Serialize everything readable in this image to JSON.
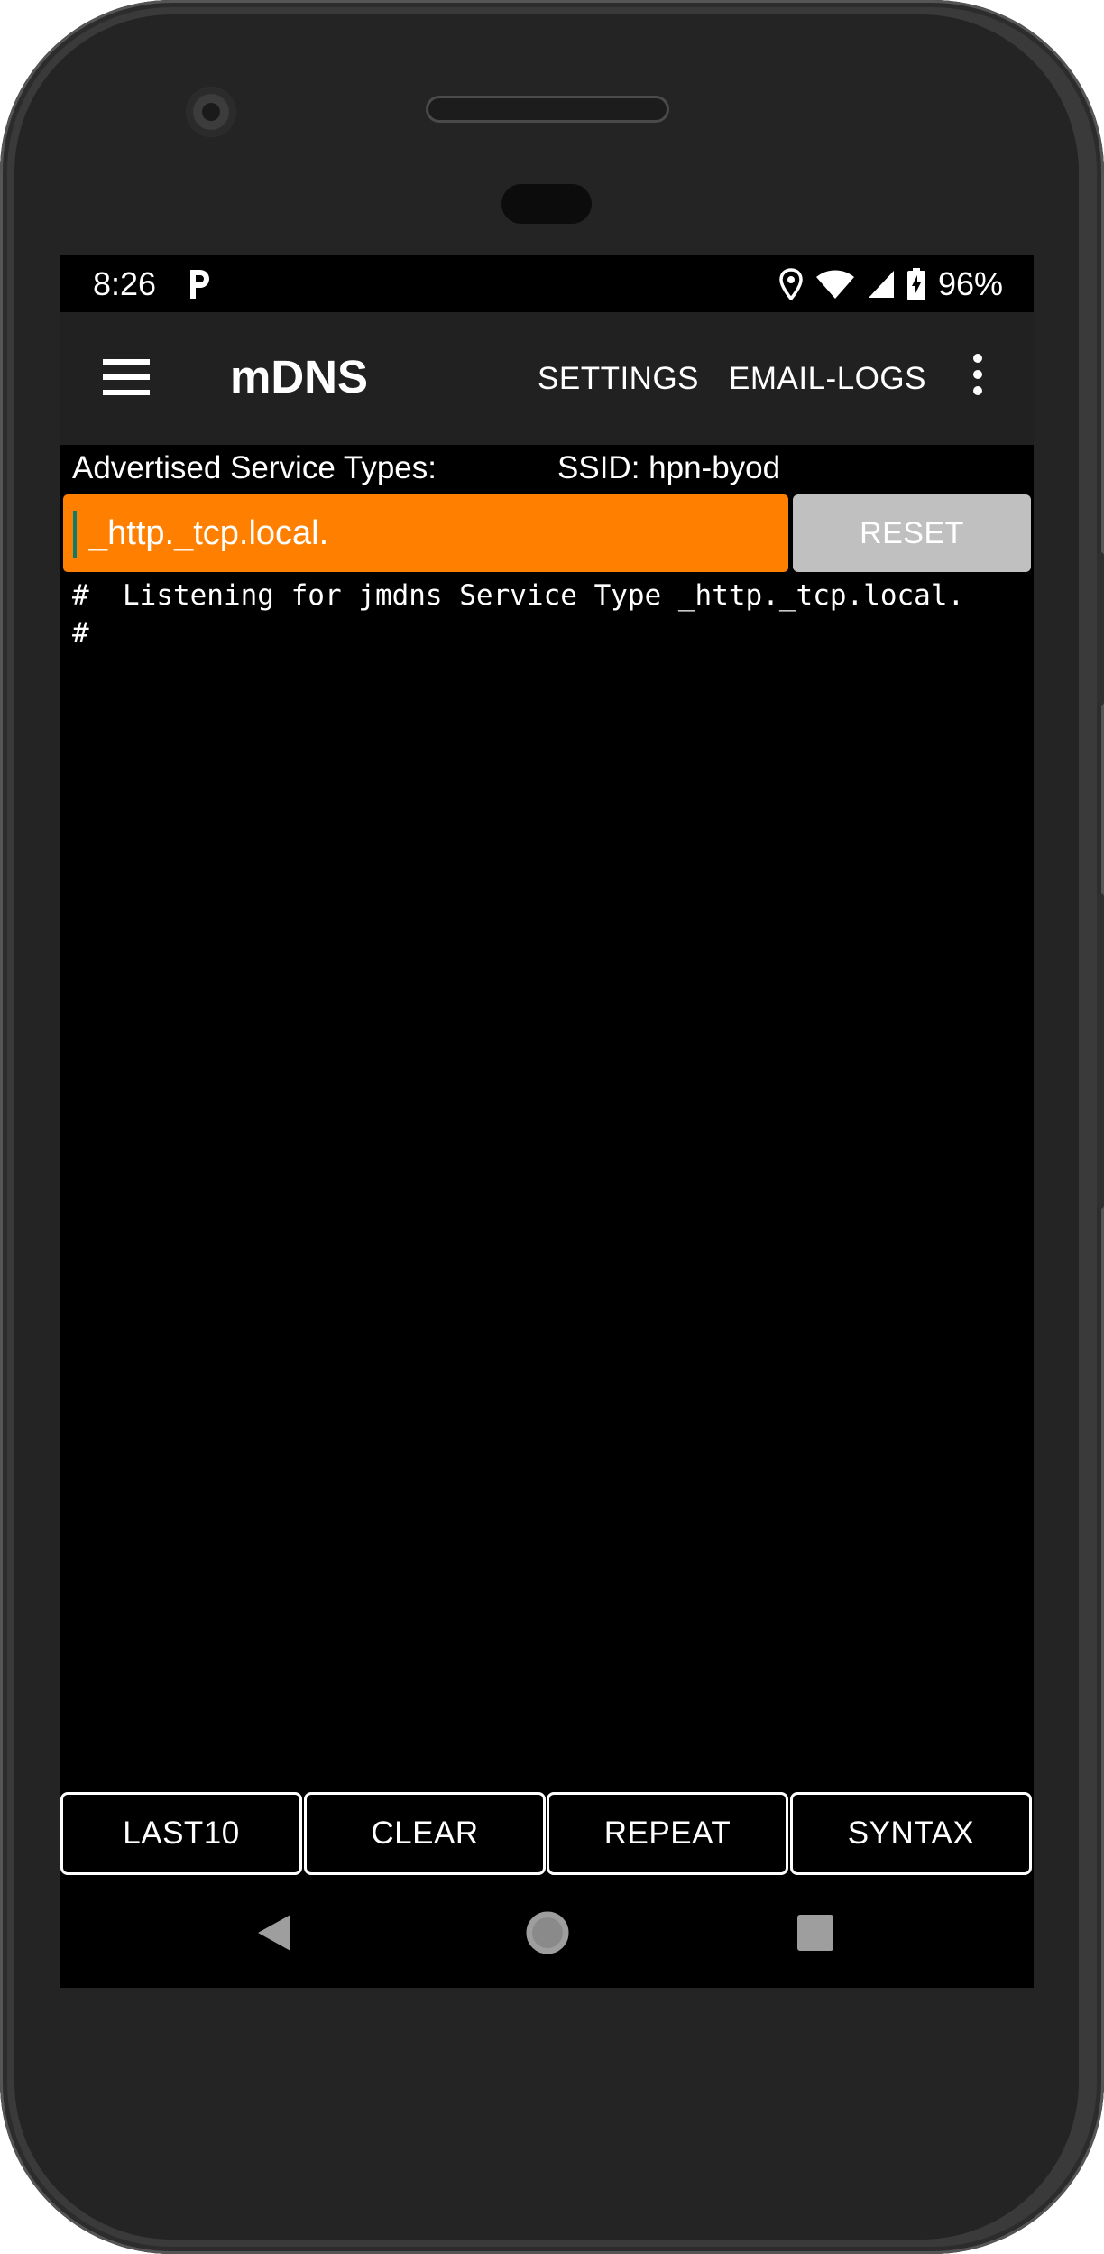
{
  "status_bar": {
    "time": "8:26",
    "notification_icon": "p-icon",
    "battery_percent": "96%",
    "icons": [
      "location-icon",
      "wifi-icon",
      "cell-signal-icon",
      "battery-charging-icon"
    ]
  },
  "toolbar": {
    "title": "mDNS",
    "menu_icon": "hamburger-menu-icon",
    "actions": {
      "settings": "SETTINGS",
      "email_logs": "EMAIL-LOGS"
    },
    "overflow_icon": "more-vert-icon"
  },
  "info": {
    "label": "Advertised Service Types:",
    "ssid": "SSID: hpn-byod"
  },
  "service_input": {
    "value": "_http._tcp.local."
  },
  "reset_label": "RESET",
  "log": {
    "lines": [
      "#  Listening for jmdns Service Type _http._tcp.local.",
      "#"
    ]
  },
  "bottom_buttons": {
    "last10": "LAST10",
    "clear": "CLEAR",
    "repeat": "REPEAT",
    "syntax": "SYNTAX"
  },
  "nav_bar": {
    "icons": [
      "back-icon",
      "home-icon",
      "recents-icon"
    ]
  },
  "colors": {
    "accent_input": "#ff8000",
    "reset_button": "#c0c0c0",
    "toolbar": "#212121",
    "background": "#000000",
    "device_frame": "#242424"
  }
}
